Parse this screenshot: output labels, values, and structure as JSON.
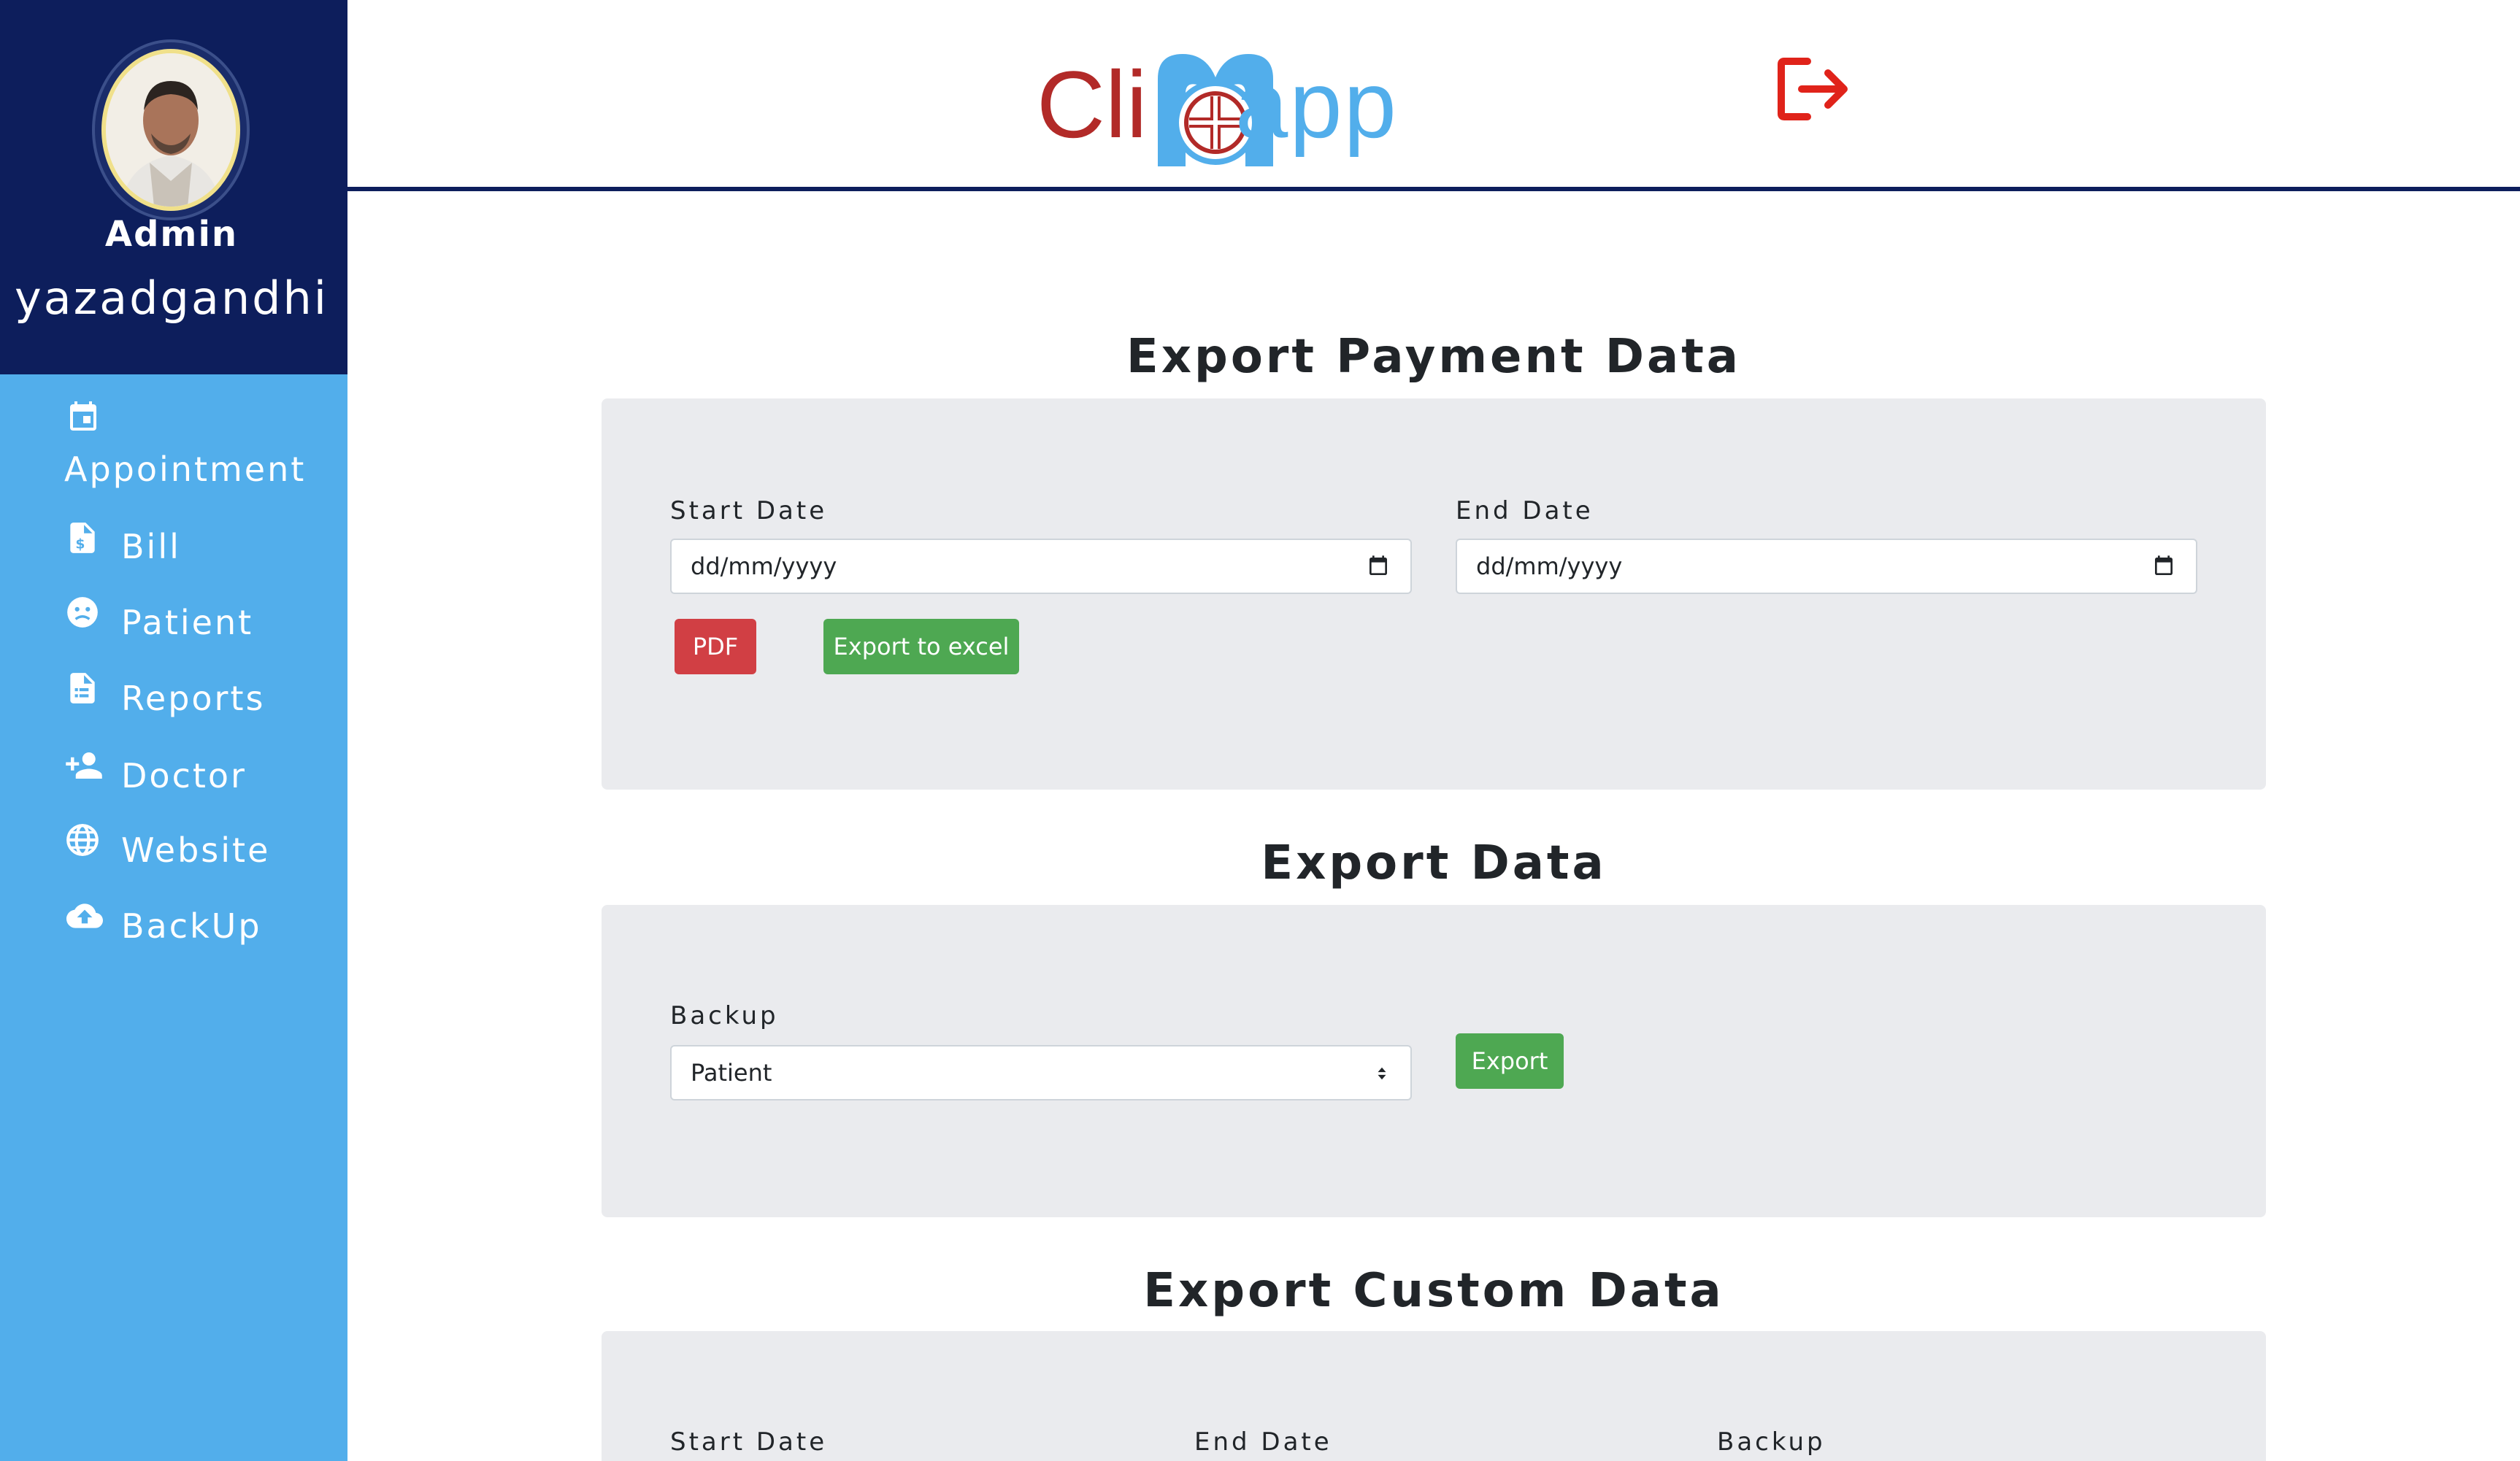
{
  "app": {
    "logo_left": "Cli",
    "logo_right": "app"
  },
  "user": {
    "role": "Admin",
    "name": "yazadgandhi"
  },
  "sidebar": {
    "items": [
      {
        "label": "Appointment",
        "icon": "calendar-icon"
      },
      {
        "label": "Bill",
        "icon": "invoice-icon"
      },
      {
        "label": "Patient",
        "icon": "patient-icon"
      },
      {
        "label": "Reports",
        "icon": "report-icon"
      },
      {
        "label": "Doctor",
        "icon": "add-person-icon"
      },
      {
        "label": "Website",
        "icon": "globe-icon"
      },
      {
        "label": "BackUp",
        "icon": "cloud-upload-icon"
      }
    ]
  },
  "payment_export": {
    "title": "Export Payment Data",
    "start_label": "Start Date",
    "start_value": "dd/mm/yyyy",
    "end_label": "End Date",
    "end_value": "dd/mm/yyyy",
    "pdf_label": "PDF",
    "excel_label": "Export to excel"
  },
  "data_export": {
    "title": "Export Data",
    "backup_label": "Backup",
    "backup_selected": "Patient",
    "export_label": "Export"
  },
  "custom_export": {
    "title": "Export Custom Data",
    "start_label": "Start Date",
    "end_label": "End Date",
    "backup_label": "Backup"
  },
  "colors": {
    "sidebar_dark": "#0d1e5c",
    "sidebar_light": "#52aeeb",
    "danger": "#d13f44",
    "success": "#4ea852",
    "logout": "#e0231a"
  }
}
